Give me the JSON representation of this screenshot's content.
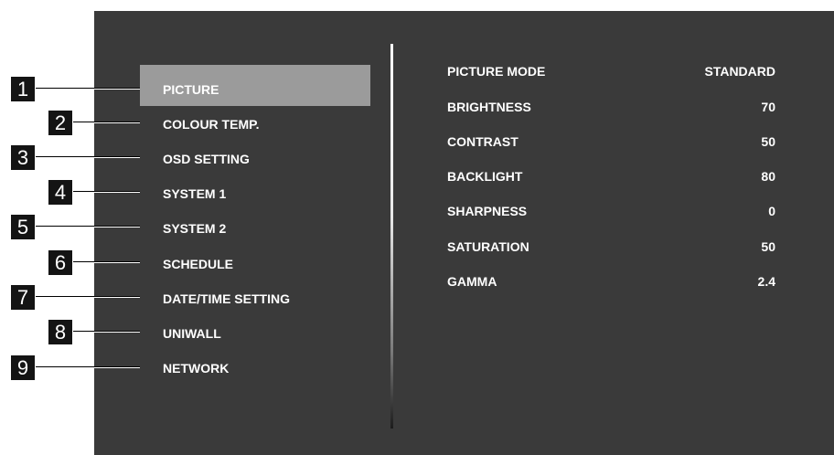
{
  "menu": {
    "items": [
      {
        "label": "PICTURE",
        "selected": true
      },
      {
        "label": "COLOUR TEMP."
      },
      {
        "label": "OSD SETTING"
      },
      {
        "label": "SYSTEM 1"
      },
      {
        "label": "SYSTEM 2"
      },
      {
        "label": "SCHEDULE"
      },
      {
        "label": "DATE/TIME SETTING"
      },
      {
        "label": "UNIWALL"
      },
      {
        "label": "NETWORK"
      }
    ]
  },
  "settings": [
    {
      "label": "PICTURE MODE",
      "value": "STANDARD"
    },
    {
      "label": "BRIGHTNESS",
      "value": "70"
    },
    {
      "label": "CONTRAST",
      "value": "50"
    },
    {
      "label": "BACKLIGHT",
      "value": "80"
    },
    {
      "label": "SHARPNESS",
      "value": "0"
    },
    {
      "label": "SATURATION",
      "value": "50"
    },
    {
      "label": "GAMMA",
      "value": "2.4"
    }
  ],
  "callouts": [
    "1",
    "2",
    "3",
    "4",
    "5",
    "6",
    "7",
    "8",
    "9"
  ],
  "colors": {
    "panel": "#3a3a3a",
    "highlight": "#9b9b9b",
    "text": "#ffffff",
    "callout": "#141414"
  }
}
